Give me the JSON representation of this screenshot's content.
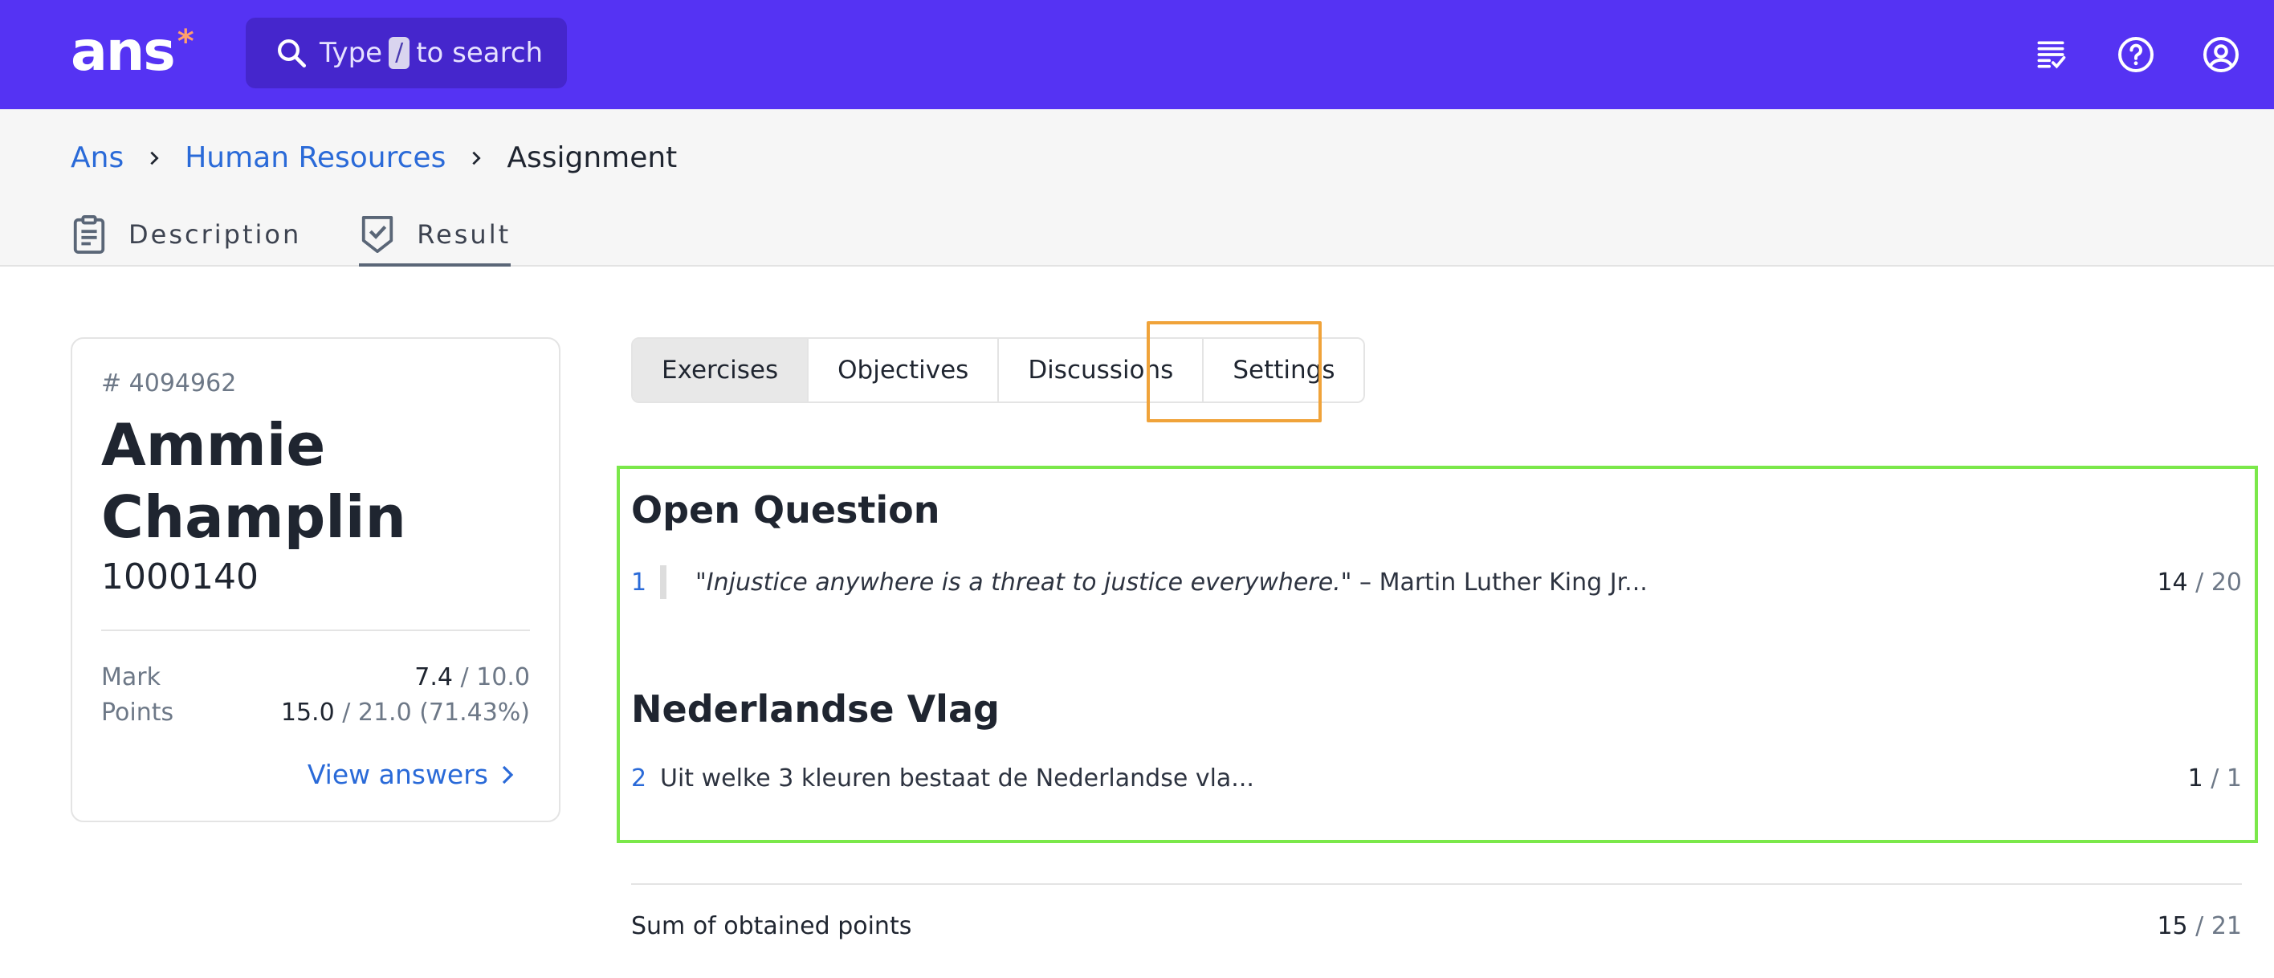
{
  "header": {
    "logo_text": "ans",
    "logo_mark": "*",
    "search": {
      "prefix": "Type",
      "key": "/",
      "suffix": "to search"
    },
    "icons": [
      "list-check-icon",
      "help-circle-icon",
      "user-account-icon"
    ],
    "brand_color": "#5533f3"
  },
  "breadcrumb": {
    "items": [
      "Ans",
      "Human Resources"
    ],
    "current": "Assignment"
  },
  "page_tabs": [
    {
      "label": "Description",
      "icon": "clipboard-icon"
    },
    {
      "label": "Result",
      "icon": "shield-check-icon",
      "active": true
    }
  ],
  "candidate": {
    "id": "# 4094962",
    "name_line1": "Ammie",
    "name_line2": "Champlin",
    "number": "1000140",
    "mark_label": "Mark",
    "mark_value": "7.4",
    "mark_total": "/ 10.0",
    "points_label": "Points",
    "points_value": "15.0",
    "points_total": "/ 21.0 (71.43%)",
    "view_answers": "View answers"
  },
  "result_tabs": [
    {
      "label": "Exercises",
      "active": true
    },
    {
      "label": "Objectives"
    },
    {
      "label": "Discussions"
    },
    {
      "label": "Settings"
    }
  ],
  "exercises": [
    {
      "section": "Open Question",
      "number": "1",
      "quote": "\"Injustice anywhere is a threat to justice everywhere.\"",
      "text": " – Martin Luther King Jr...",
      "score": "14",
      "total": "/ 20"
    },
    {
      "section": "Nederlandse Vlag",
      "number": "2",
      "text": "Uit welke 3 kleuren bestaat de Nederlandse vla...",
      "score": "1",
      "total": "/ 1"
    }
  ],
  "sum": {
    "label": "Sum of obtained points",
    "value": "15",
    "total": "/ 21"
  }
}
